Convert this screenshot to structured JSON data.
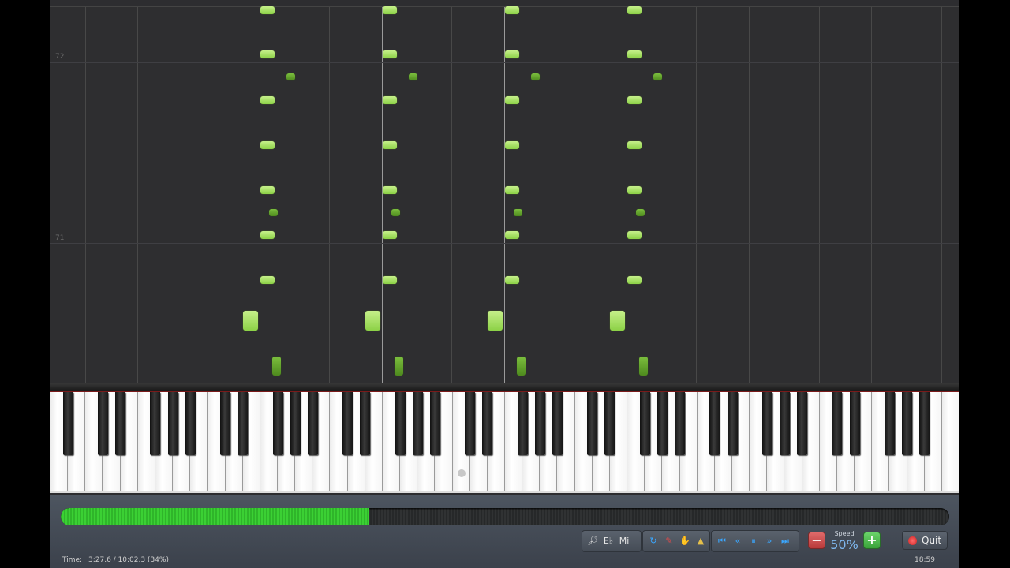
{
  "piano_roll": {
    "measure_numbers": [
      "72",
      "71"
    ]
  },
  "progress": {
    "fraction": 0.347
  },
  "status": {
    "time_label": "Time:",
    "time_value": "3:27.6 / 10:02.3 (34%)",
    "clock": "18:59"
  },
  "toolbar": {
    "left_group": [
      {
        "name": "zoom-tool",
        "icon": "magnifier-icon",
        "glyph": "🔎︎",
        "style": ""
      },
      {
        "name": "e-flat-key",
        "icon": "eb-label",
        "glyph": "E♭",
        "style": ""
      },
      {
        "name": "mi-label",
        "icon": "mi-label",
        "glyph": "Mi",
        "style": ""
      }
    ],
    "tool_group": [
      {
        "name": "loop-tool",
        "icon": "loop-icon",
        "glyph": "↻",
        "style": "blue"
      },
      {
        "name": "pencil-tool",
        "icon": "pencil-icon",
        "glyph": "✎",
        "style": "red"
      },
      {
        "name": "hand-tool",
        "icon": "hand-icon",
        "glyph": "✋",
        "style": "orange"
      },
      {
        "name": "metronome-tool",
        "icon": "metronome-icon",
        "glyph": "▲",
        "style": "gold"
      }
    ],
    "transport_group": [
      {
        "name": "skip-start-button",
        "icon": "skip-start-icon",
        "glyph": "⏮",
        "style": "blue"
      },
      {
        "name": "rewind-button",
        "icon": "rewind-icon",
        "glyph": "«",
        "style": "blue"
      },
      {
        "name": "pause-button",
        "icon": "pause-icon",
        "glyph": "⏸",
        "style": "blue"
      },
      {
        "name": "fast-forward-button",
        "icon": "fast-forward-icon",
        "glyph": "»",
        "style": "blue"
      },
      {
        "name": "skip-end-button",
        "icon": "skip-end-icon",
        "glyph": "⏭",
        "style": "blue"
      }
    ],
    "speed_label": "Speed",
    "speed_value": "50%",
    "minus_glyph": "−",
    "plus_glyph": "+",
    "quit_label": "Quit"
  }
}
